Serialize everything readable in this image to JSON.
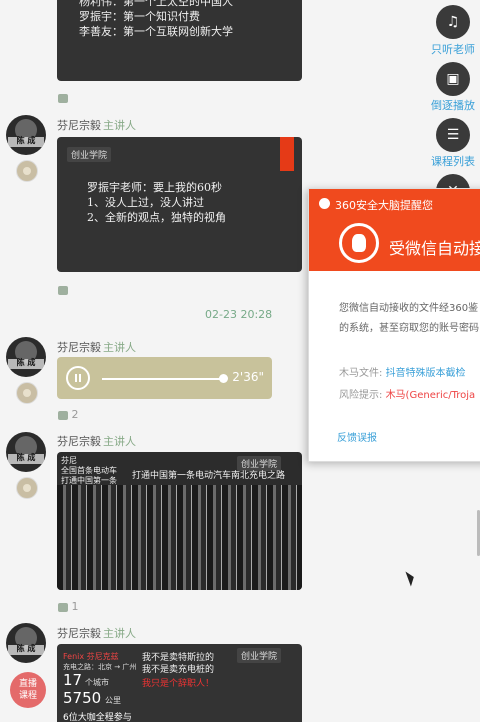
{
  "messages": [
    {
      "slide_lines": "杨利伟：第一个上太空的中国人\n罗振宇：第一个知识付费\n李善友：第一个互联网创新大学",
      "likes": ""
    },
    {
      "author": "芬尼宗毅",
      "role": "主讲人",
      "avatar_text": "陈 成",
      "slide_logo": "创业学院",
      "slide_lines": "罗振宇老师：要上我的60秒\n1、没人上过，没人讲过\n2、全新的观点，独特的视角",
      "likes": ""
    },
    {
      "timestamp": "02-23 20:28",
      "author": "芬尼宗毅",
      "role": "主讲人",
      "avatar_text": "陈 成",
      "audio_duration": "2'36\"",
      "audio_progress": 0.93,
      "likes": "2"
    },
    {
      "author": "芬尼宗毅",
      "role": "主讲人",
      "avatar_text": "陈 成",
      "slide_logo": "创业学院",
      "slide_headline": "打通中国第一条电动汽车南北充电之路",
      "slide_left_lines": "芬尼\n全国首条电动车\n打通中国第一条\n电动汽车充电之路",
      "likes": "1"
    },
    {
      "author": "芬尼宗毅",
      "role": "主讲人",
      "avatar_text": "陈 成",
      "sub_badge_text": "直播\n课程",
      "slide_logo": "创业学院",
      "slide_left_top": "Fenix 芬尼克兹",
      "slide_left_city": "充电之路：北京 → 广州",
      "slide_count": "17",
      "slide_count_unit": "个城市",
      "slide_distance": "5750",
      "slide_distance_unit": "公里",
      "slide_more": "6位大咖全程参与",
      "slide_right_lines": "我不是卖特斯拉的\n我不是卖充电桩的",
      "slide_right_red": "我只是个辞职人！"
    }
  ],
  "sidebar": [
    {
      "label": "只听老师",
      "icon": "headphone-icon"
    },
    {
      "label": "倒逐播放",
      "icon": "reverse-play-icon"
    },
    {
      "label": "课程列表",
      "icon": "list-icon"
    },
    {
      "label": "",
      "icon": "close-icon"
    }
  ],
  "popup": {
    "title": "360安全大脑提醒您",
    "heading": "受微信自动接收",
    "desc1": "您微信自动接收的文件经360鉴",
    "desc2": "的系统，甚至窃取您的账号密码",
    "file_key": "木马文件:",
    "file_val": "抖音特殊版本截检",
    "risk_key": "风险提示:",
    "risk_val": "木马(Generic/Troja",
    "feedback": "反馈误报",
    "accent": "#f04a1e"
  }
}
